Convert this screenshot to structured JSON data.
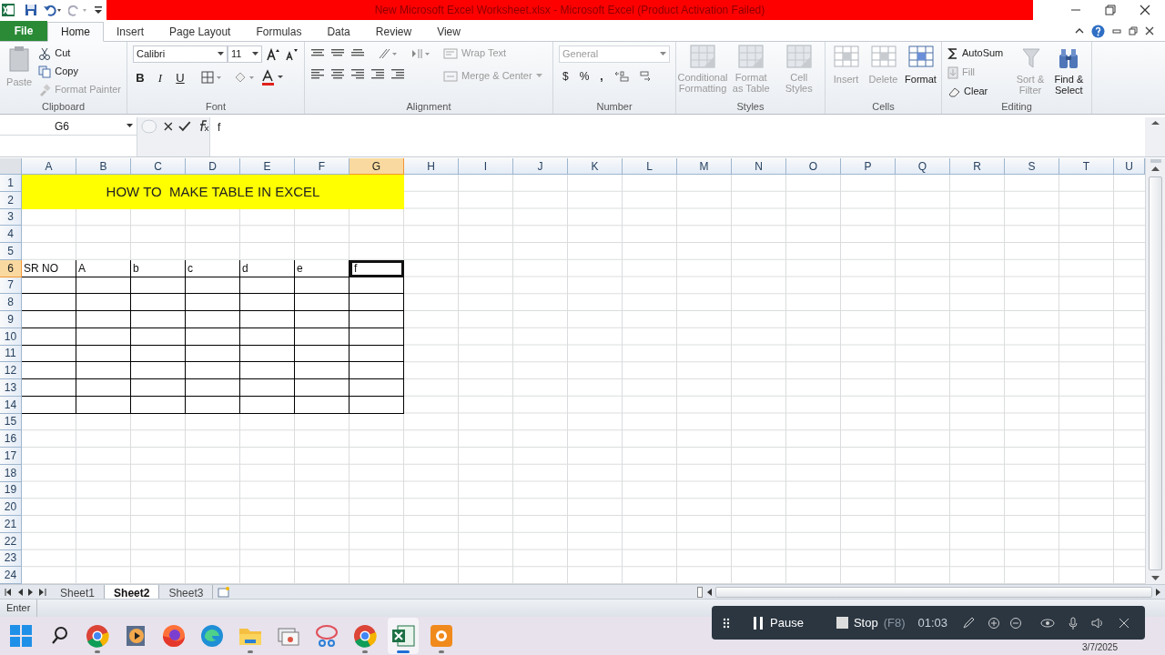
{
  "title_bar": {
    "title": "New Microsoft Excel Worksheet.xlsx  -  Microsoft Excel (Product Activation Failed)"
  },
  "ribbon_tabs": [
    {
      "label": "File",
      "kind": "file",
      "selected": false
    },
    {
      "label": "Home",
      "kind": "tab",
      "selected": true
    },
    {
      "label": "Insert",
      "kind": "tab",
      "selected": false
    },
    {
      "label": "Page Layout",
      "kind": "tab",
      "selected": false
    },
    {
      "label": "Formulas",
      "kind": "tab",
      "selected": false
    },
    {
      "label": "Data",
      "kind": "tab",
      "selected": false
    },
    {
      "label": "Review",
      "kind": "tab",
      "selected": false
    },
    {
      "label": "View",
      "kind": "tab",
      "selected": false
    }
  ],
  "clipboard": {
    "label": "Clipboard",
    "paste": {
      "label": "Paste",
      "disabled": true
    },
    "cut": {
      "label": "Cut",
      "disabled": false
    },
    "copy": {
      "label": "Copy",
      "disabled": false
    },
    "format_painter": {
      "label": "Format Painter",
      "disabled": true
    }
  },
  "font": {
    "label": "Font",
    "family": "Calibri",
    "size": "11",
    "style_buttons": [
      "B",
      "I",
      "U"
    ]
  },
  "alignment": {
    "label": "Alignment",
    "wrap_text": {
      "label": "Wrap Text",
      "disabled": true
    },
    "merge": {
      "label": "Merge & Center",
      "disabled": true
    }
  },
  "number": {
    "label": "Number",
    "format": "General",
    "currency": "$",
    "percent": "%",
    "comma": ","
  },
  "styles": {
    "label": "Styles",
    "buttons": [
      {
        "label": "Conditional Formatting",
        "disabled": true
      },
      {
        "label": "Format as Table",
        "disabled": true
      },
      {
        "label": "Cell Styles",
        "disabled": true
      }
    ]
  },
  "cells": {
    "label": "Cells",
    "buttons": [
      {
        "label": "Insert",
        "disabled": true
      },
      {
        "label": "Delete",
        "disabled": true
      },
      {
        "label": "Format",
        "disabled": false
      }
    ]
  },
  "editing": {
    "label": "Editing",
    "autosum": {
      "label": "AutoSum",
      "disabled": false
    },
    "fill": {
      "label": "Fill",
      "disabled": true
    },
    "clear": {
      "label": "Clear",
      "disabled": false
    },
    "sort_filter": {
      "label": "Sort & Filter",
      "disabled": true
    },
    "find_select": {
      "label": "Find & Select",
      "disabled": false
    }
  },
  "formula_bar": {
    "name_box": "G6",
    "value": "f"
  },
  "columns": [
    {
      "label": "A",
      "selected": false
    },
    {
      "label": "B",
      "selected": false
    },
    {
      "label": "C",
      "selected": false
    },
    {
      "label": "D",
      "selected": false
    },
    {
      "label": "E",
      "selected": false
    },
    {
      "label": "F",
      "selected": false
    },
    {
      "label": "G",
      "selected": true
    },
    {
      "label": "H",
      "selected": false
    },
    {
      "label": "I",
      "selected": false
    },
    {
      "label": "J",
      "selected": false
    },
    {
      "label": "K",
      "selected": false
    },
    {
      "label": "L",
      "selected": false
    },
    {
      "label": "M",
      "selected": false
    },
    {
      "label": "N",
      "selected": false
    },
    {
      "label": "O",
      "selected": false
    },
    {
      "label": "P",
      "selected": false
    },
    {
      "label": "Q",
      "selected": false
    },
    {
      "label": "R",
      "selected": false
    },
    {
      "label": "S",
      "selected": false
    },
    {
      "label": "T",
      "selected": false
    },
    {
      "label": "U",
      "selected": false
    }
  ],
  "rows": [
    {
      "label": "1",
      "selected": false,
      "bordered": false
    },
    {
      "label": "2",
      "selected": false,
      "bordered": false
    },
    {
      "label": "3",
      "selected": false,
      "bordered": false
    },
    {
      "label": "4",
      "selected": false,
      "bordered": false
    },
    {
      "label": "5",
      "selected": false,
      "bordered": false
    },
    {
      "label": "6",
      "selected": true,
      "bordered": true
    },
    {
      "label": "7",
      "selected": false,
      "bordered": true
    },
    {
      "label": "8",
      "selected": false,
      "bordered": true
    },
    {
      "label": "9",
      "selected": false,
      "bordered": true
    },
    {
      "label": "10",
      "selected": false,
      "bordered": true
    },
    {
      "label": "11",
      "selected": false,
      "bordered": true
    },
    {
      "label": "12",
      "selected": false,
      "bordered": true
    },
    {
      "label": "13",
      "selected": false,
      "bordered": true
    },
    {
      "label": "14",
      "selected": false,
      "bordered": true
    },
    {
      "label": "15",
      "selected": false,
      "bordered": false
    },
    {
      "label": "16",
      "selected": false,
      "bordered": false
    },
    {
      "label": "17",
      "selected": false,
      "bordered": false
    },
    {
      "label": "18",
      "selected": false,
      "bordered": false
    },
    {
      "label": "19",
      "selected": false,
      "bordered": false
    },
    {
      "label": "20",
      "selected": false,
      "bordered": false
    },
    {
      "label": "21",
      "selected": false,
      "bordered": false
    },
    {
      "label": "22",
      "selected": false,
      "bordered": false
    },
    {
      "label": "23",
      "selected": false,
      "bordered": false
    },
    {
      "label": "24",
      "selected": false,
      "bordered": false
    }
  ],
  "title_cell": "HOW TO  MAKE TABLE IN EXCEL",
  "table_header": [
    {
      "text": "SR NO",
      "selected": false
    },
    {
      "text": "A",
      "selected": false
    },
    {
      "text": "b",
      "selected": false
    },
    {
      "text": "c",
      "selected": false
    },
    {
      "text": "d",
      "selected": false
    },
    {
      "text": "e",
      "selected": false
    },
    {
      "text": "f",
      "selected": true
    }
  ],
  "sheet_tabs": [
    {
      "label": "Sheet1",
      "selected": false
    },
    {
      "label": "Sheet2",
      "selected": true
    },
    {
      "label": "Sheet3",
      "selected": false
    }
  ],
  "status_bar": {
    "mode": "Enter"
  },
  "recorder": {
    "pause": "Pause",
    "stop": "Stop",
    "shortcut": "(F8)",
    "time": "01:03"
  },
  "taskbar": {
    "date": "3/7/2025",
    "apps": [
      {
        "kind": "start",
        "running": false,
        "active": false
      },
      {
        "kind": "search",
        "running": false,
        "active": false
      },
      {
        "kind": "chrome",
        "running": true,
        "active": false
      },
      {
        "kind": "media",
        "running": false,
        "active": false
      },
      {
        "kind": "firefox",
        "running": false,
        "active": false
      },
      {
        "kind": "edge",
        "running": false,
        "active": false
      },
      {
        "kind": "folder",
        "running": true,
        "active": false
      },
      {
        "kind": "windows",
        "running": false,
        "active": false
      },
      {
        "kind": "scissors",
        "running": false,
        "active": false
      },
      {
        "kind": "chrome",
        "running": true,
        "active": false
      },
      {
        "kind": "excel",
        "running": true,
        "active": true
      },
      {
        "kind": "recorder",
        "running": true,
        "active": false
      }
    ]
  }
}
